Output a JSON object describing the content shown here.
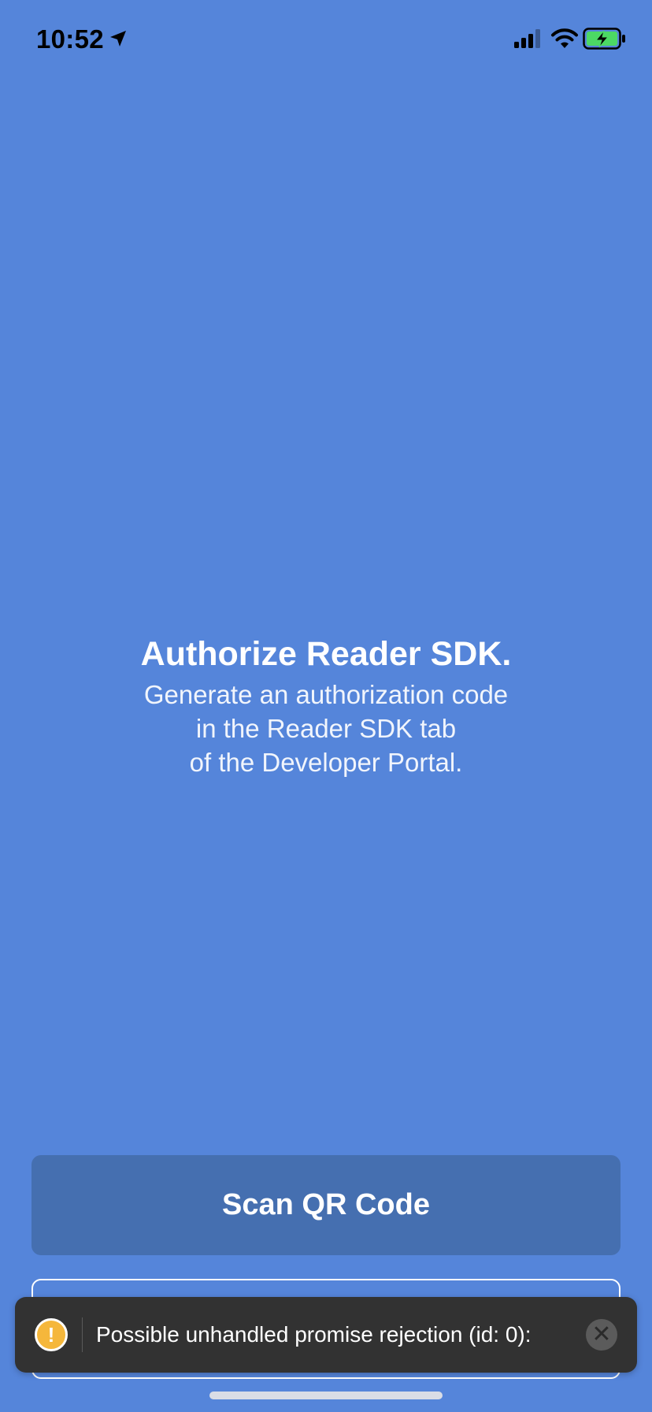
{
  "status_bar": {
    "time": "10:52",
    "location_icon": "location-arrow-icon",
    "signal_icon": "cellular-signal-icon",
    "wifi_icon": "wifi-icon",
    "battery_icon": "battery-charging-icon",
    "battery_color": "#4CD964"
  },
  "auth": {
    "title": "Authorize Reader SDK.",
    "lines": [
      "Generate an authorization code",
      "in the Reader SDK tab",
      "of the Developer Portal."
    ]
  },
  "buttons": {
    "scan_label": "Scan QR Code"
  },
  "toast": {
    "icon": "warning-icon",
    "icon_glyph": "!",
    "message": "Possible unhandled promise rejection (id: 0):",
    "close_icon": "close-icon",
    "close_glyph": "✕"
  },
  "colors": {
    "background": "#5585DA",
    "scan_button": "#456FB0",
    "toast_background": "#323232",
    "warning": "#F5B73B"
  }
}
